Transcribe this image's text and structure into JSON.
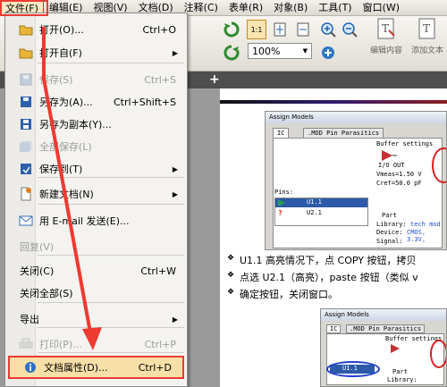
{
  "menubar": {
    "items": [
      "文件(F)",
      "编辑(E)",
      "视图(V)",
      "文档(D)",
      "注释(C)",
      "表单(R)",
      "对象(B)",
      "工具(T)",
      "窗口(W)"
    ]
  },
  "toolbar": {
    "zoom": "100%",
    "actual_size_label": "1:1",
    "plugin1": "编辑内容",
    "plugin2": "添加文本"
  },
  "tabbar": {
    "new_tab": "+"
  },
  "file_menu": [
    {
      "label": "打开(O)...",
      "shortcut": "Ctrl+O",
      "icon": "folder-open-icon",
      "enabled": true,
      "submenu": false
    },
    {
      "label": "打开自(F)",
      "shortcut": "",
      "icon": "folder-open-icon",
      "enabled": true,
      "submenu": true
    },
    {
      "label": "保存(S)",
      "shortcut": "Ctrl+S",
      "icon": "save-icon",
      "enabled": false,
      "submenu": false
    },
    {
      "label": "另存为(A)...",
      "shortcut": "Ctrl+Shift+S",
      "icon": "save-as-icon",
      "enabled": true,
      "submenu": false
    },
    {
      "label": "另存为副本(Y)...",
      "shortcut": "",
      "icon": "save-copy-icon",
      "enabled": true,
      "submenu": false
    },
    {
      "label": "全部保存(L)",
      "shortcut": "",
      "icon": "save-all-icon",
      "enabled": false,
      "submenu": false
    },
    {
      "label": "保存到(T)",
      "shortcut": "",
      "icon": "save-to-icon",
      "enabled": true,
      "submenu": true
    },
    {
      "label": "新建文档(N)",
      "shortcut": "",
      "icon": "new-document-icon",
      "enabled": true,
      "submenu": true
    },
    {
      "label": "用 E-mail 发送(E)...",
      "shortcut": "",
      "icon": "email-icon",
      "enabled": true,
      "submenu": false
    },
    {
      "label": "回复(V)",
      "shortcut": "",
      "icon": "",
      "enabled": false,
      "submenu": false
    },
    {
      "label": "关闭(C)",
      "shortcut": "Ctrl+W",
      "icon": "",
      "enabled": true,
      "submenu": false
    },
    {
      "label": "关闭全部(S)",
      "shortcut": "",
      "icon": "",
      "enabled": true,
      "submenu": false
    },
    {
      "label": "导出",
      "shortcut": "",
      "icon": "",
      "enabled": true,
      "submenu": true
    },
    {
      "label": "打印(P)...",
      "shortcut": "Ctrl+P",
      "icon": "print-icon",
      "enabled": false,
      "submenu": false
    },
    {
      "label": "文档属性(D)...",
      "shortcut": "Ctrl+D",
      "icon": "info-icon",
      "enabled": true,
      "submenu": false
    }
  ],
  "document": {
    "screenshot1": {
      "title": "Assign Models",
      "tab1": "IC",
      "tab2": ".MOD Pin Parasitics",
      "buffer_settings": "Buffer settings",
      "io_out": "I/O OUT",
      "vmeas": "Vmeas=1.50 V",
      "cref": "Cref=50.0 pF",
      "pins_label": "Pins:",
      "pins": [
        "U1.1",
        "U2.1"
      ],
      "part_label": "Part",
      "library_label": "Library:",
      "library_value": "tech mod",
      "device_label": "Device:",
      "device_value": "CMOS, 3.3V,",
      "signal_label": "Signal:"
    },
    "bullets": [
      "U1.1 高亮情况下，点 COPY 按钮，拷贝",
      "点选 U2.1（高亮），paste 按钮（类似 v",
      "确定按钮，关闭窗口。"
    ],
    "screenshot2": {
      "title": "Assign Models",
      "tab1": "IC",
      "tab2": ".MOD Pin Parasitics",
      "buffer_settings": "Buffer settings",
      "pin": "U1.1",
      "part": "Part",
      "library": "Library:"
    }
  },
  "colors": {
    "annotation": "#ee3a31",
    "menu_highlight": "#fbe7c2"
  }
}
